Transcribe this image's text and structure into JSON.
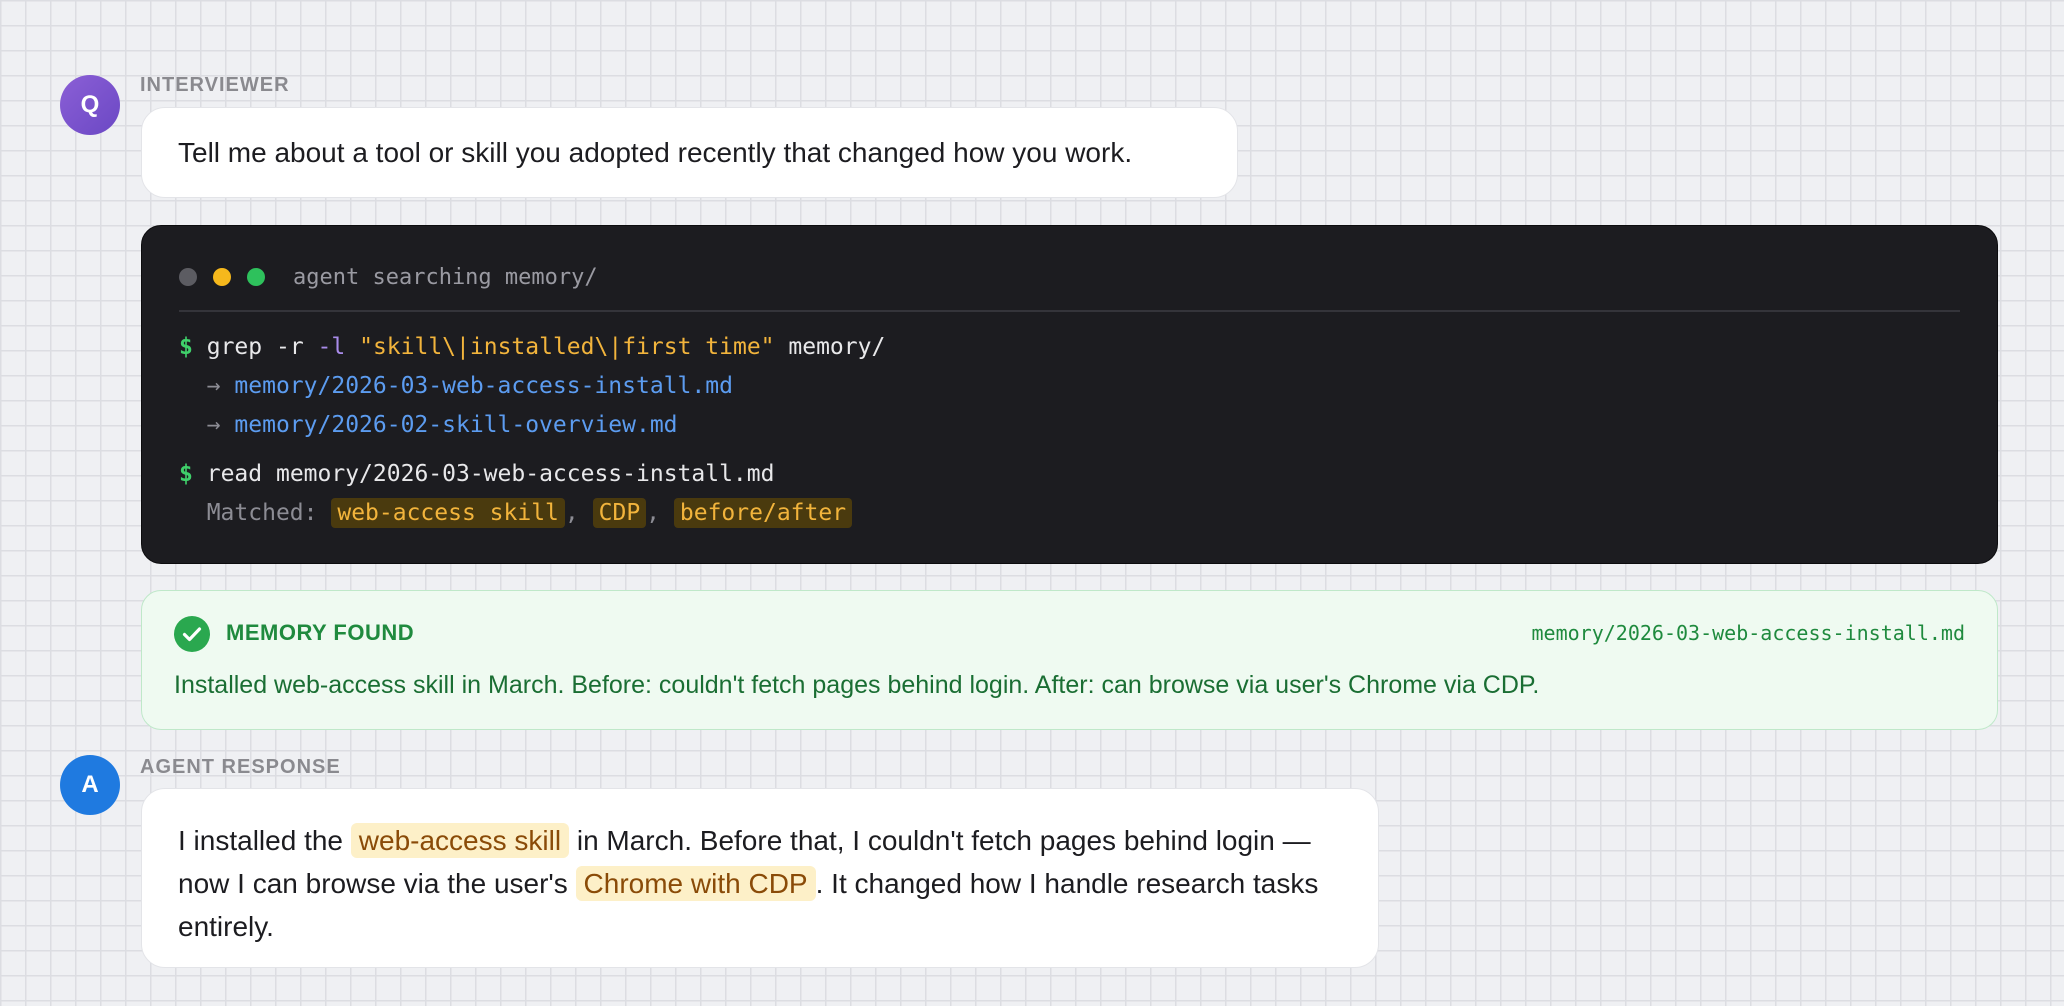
{
  "interviewer": {
    "avatar_letter": "Q",
    "label": "INTERVIEWER",
    "question": "Tell me about a tool or skill you adopted recently that changed how you work."
  },
  "terminal": {
    "title": "agent searching memory/",
    "prompt_symbol": "$",
    "arrow_symbol": "→",
    "cmd1": {
      "command": "grep",
      "flag_r": "-r",
      "flag_l": "-l",
      "pattern": "\"skill\\|installed\\|first time\"",
      "target": "memory/"
    },
    "results": [
      "memory/2026-03-web-access-install.md",
      "memory/2026-02-skill-overview.md"
    ],
    "cmd2": {
      "command": "read",
      "target": "memory/2026-03-web-access-install.md"
    },
    "matched_label": "Matched:",
    "matched_tags": [
      "web-access skill",
      "CDP",
      "before/after"
    ],
    "separator": ","
  },
  "memory": {
    "title": "MEMORY FOUND",
    "path": "memory/2026-03-web-access-install.md",
    "text": "Installed web-access skill in March. Before: couldn't fetch pages behind login. After: can browse via user's Chrome via CDP."
  },
  "agent": {
    "avatar_letter": "A",
    "label": "AGENT RESPONSE",
    "parts": {
      "p1": "I installed the ",
      "h1": "web-access skill",
      "p2": " in March. Before that, I couldn't fetch pages behind login — now I can browse via the user's ",
      "h2": "Chrome with CDP",
      "p3": ". It changed how I handle research tasks entirely."
    }
  },
  "colors": {
    "background": "#eff0f3",
    "terminal_bg": "#1c1c20",
    "memory_bg": "#effaf1",
    "accent_green": "#1f8a3e",
    "highlight_bg": "#fdf0c8"
  },
  "icons": {
    "memory_found": "check-circle-icon"
  }
}
